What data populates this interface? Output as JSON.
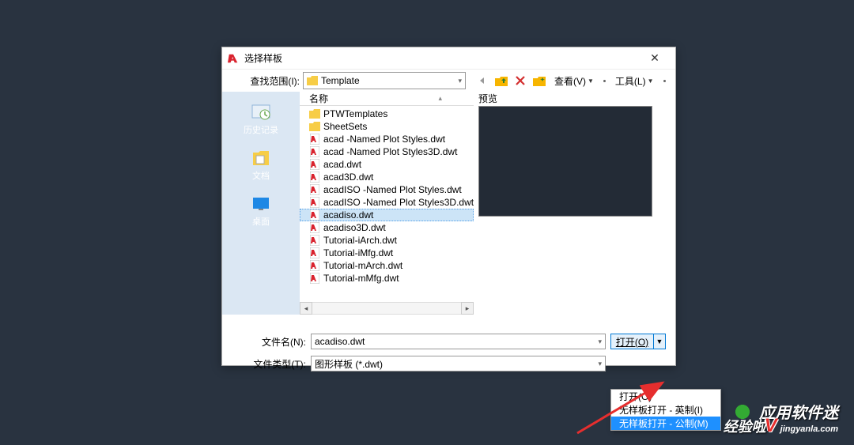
{
  "dialog": {
    "title": "选择样板",
    "look_in_label": "查找范围(I):",
    "look_in_value": "Template",
    "view_btn": "查看(V)",
    "tools_btn": "工具(L)"
  },
  "sidebar": {
    "history": "历史记录",
    "documents": "文档",
    "desktop": "桌面"
  },
  "list": {
    "header_name": "名称",
    "preview_label": "预览",
    "items": [
      {
        "name": "PTWTemplates",
        "type": "folder"
      },
      {
        "name": "SheetSets",
        "type": "folder"
      },
      {
        "name": "acad -Named Plot Styles.dwt",
        "type": "dwt"
      },
      {
        "name": "acad -Named Plot Styles3D.dwt",
        "type": "dwt"
      },
      {
        "name": "acad.dwt",
        "type": "dwt"
      },
      {
        "name": "acad3D.dwt",
        "type": "dwt"
      },
      {
        "name": "acadISO -Named Plot Styles.dwt",
        "type": "dwt"
      },
      {
        "name": "acadISO -Named Plot Styles3D.dwt",
        "type": "dwt"
      },
      {
        "name": "acadiso.dwt",
        "type": "dwt",
        "selected": true
      },
      {
        "name": "acadiso3D.dwt",
        "type": "dwt"
      },
      {
        "name": "Tutorial-iArch.dwt",
        "type": "dwt"
      },
      {
        "name": "Tutorial-iMfg.dwt",
        "type": "dwt"
      },
      {
        "name": "Tutorial-mArch.dwt",
        "type": "dwt"
      },
      {
        "name": "Tutorial-mMfg.dwt",
        "type": "dwt"
      }
    ]
  },
  "form": {
    "filename_label": "文件名(N):",
    "filename_value": "acadiso.dwt",
    "filetype_label": "文件类型(T):",
    "filetype_value": "图形样板 (*.dwt)",
    "open_btn": "打开(O)"
  },
  "dropdown": {
    "items": [
      {
        "label": "打开(O)"
      },
      {
        "label": "无样板打开 - 英制(I)"
      },
      {
        "label": "无样板打开 - 公制(M)",
        "highlighted": true
      }
    ]
  },
  "watermarks": {
    "wm1": "应用软件迷",
    "wm2a": "经验啦",
    "wm2b": "jingyanla.com"
  }
}
